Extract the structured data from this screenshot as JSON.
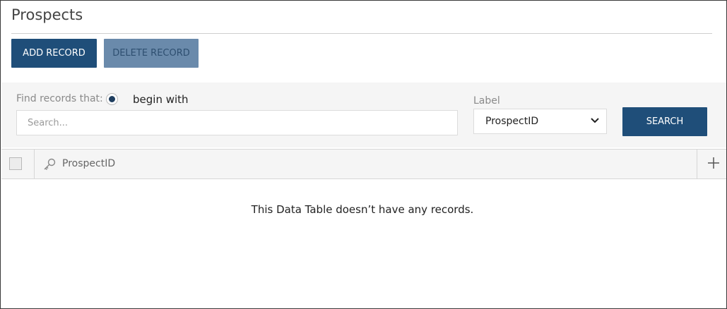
{
  "page": {
    "title": "Prospects"
  },
  "toolbar": {
    "add_label": "ADD RECORD",
    "delete_label": "DELETE RECORD"
  },
  "search": {
    "find_label": "Find records that:",
    "mode_label": "begin with",
    "mode_selected": true,
    "placeholder": "Search...",
    "value": "",
    "field_label": "Label",
    "field_selected": "ProspectID",
    "search_button": "SEARCH"
  },
  "table": {
    "columns": [
      {
        "label": "ProspectID",
        "icon": "key-icon"
      }
    ],
    "empty_message": "This Data Table doesn’t have any records."
  },
  "colors": {
    "primary": "#1f4e79",
    "disabled": "#6a8aab",
    "panel": "#f5f5f5"
  }
}
